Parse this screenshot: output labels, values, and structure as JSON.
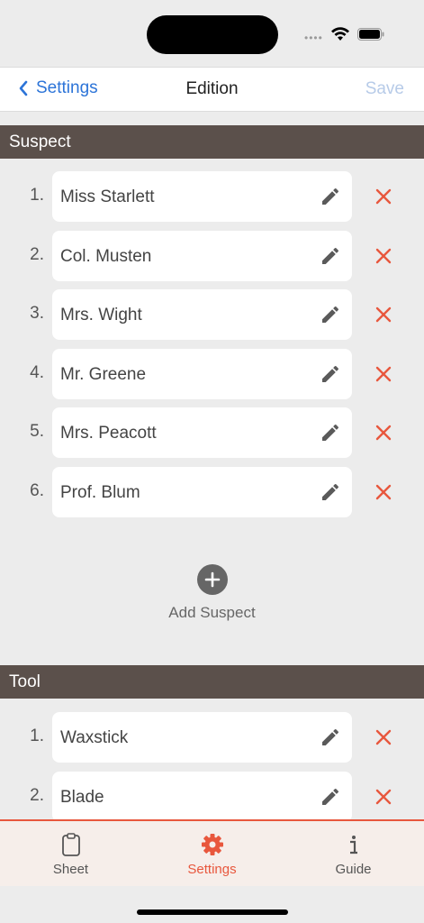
{
  "status": {
    "signal": "••••"
  },
  "nav": {
    "back_label": "Settings",
    "title": "Edition",
    "save_label": "Save"
  },
  "suspect": {
    "header": "Suspect",
    "items": [
      {
        "num": "1.",
        "name": "Miss Starlett"
      },
      {
        "num": "2.",
        "name": "Col. Musten"
      },
      {
        "num": "3.",
        "name": "Mrs. Wight"
      },
      {
        "num": "4.",
        "name": "Mr. Greene"
      },
      {
        "num": "5.",
        "name": "Mrs. Peacott"
      },
      {
        "num": "6.",
        "name": "Prof. Blum"
      }
    ],
    "add_label": "Add Suspect"
  },
  "tool": {
    "header": "Tool",
    "items": [
      {
        "num": "1.",
        "name": "Waxstick"
      },
      {
        "num": "2.",
        "name": "Blade"
      }
    ]
  },
  "tabs": [
    {
      "label": "Sheet",
      "icon": "clipboard-icon",
      "active": false
    },
    {
      "label": "Settings",
      "icon": "gear-icon",
      "active": true
    },
    {
      "label": "Guide",
      "icon": "info-icon",
      "active": false
    }
  ],
  "colors": {
    "accent": "#e8573d",
    "link": "#2c74d8",
    "header_bg": "#5b504b",
    "delete": "#e8573d"
  }
}
